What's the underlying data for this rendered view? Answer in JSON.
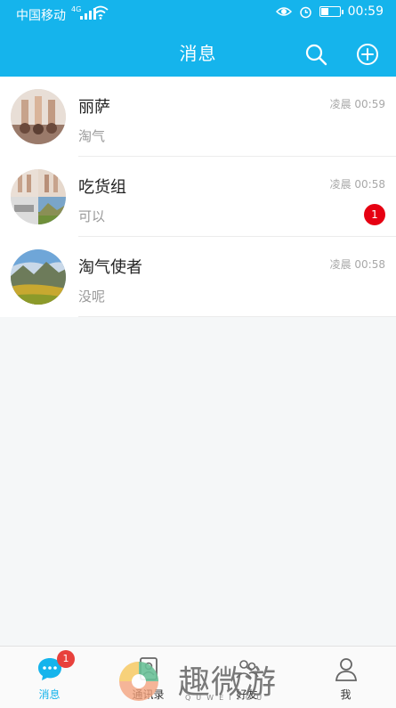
{
  "status_bar": {
    "carrier": "中国移动",
    "network": "4G",
    "time": "00:59"
  },
  "header": {
    "title": "消息",
    "icons": [
      "search-icon",
      "add-icon"
    ]
  },
  "conversations": [
    {
      "name": "丽萨",
      "preview": "淘气",
      "time": "凌晨 00:59",
      "unread": null,
      "avatar": "photo-group-beach"
    },
    {
      "name": "吃货组",
      "preview": "可以",
      "time": "凌晨 00:58",
      "unread": "1",
      "avatar": "group-collage"
    },
    {
      "name": "淘气使者",
      "preview": "没呢",
      "time": "凌晨 00:58",
      "unread": null,
      "avatar": "photo-mountain-field"
    }
  ],
  "tabbar": {
    "tabs": [
      {
        "label": "消息",
        "icon": "chat-bubble-icon",
        "badge": "1",
        "active": true
      },
      {
        "label": "通讯录",
        "icon": "contacts-icon",
        "badge": null,
        "active": false
      },
      {
        "label": "好友",
        "icon": "friends-icon",
        "badge": null,
        "active": false
      },
      {
        "label": "我",
        "icon": "person-icon",
        "badge": null,
        "active": false
      }
    ]
  },
  "watermark": {
    "text": "趣微游",
    "sub": "QUWEIYOU"
  },
  "colors": {
    "primary": "#15b4ec",
    "badge": "#e60012",
    "text": "#222222",
    "muted": "#999999"
  }
}
